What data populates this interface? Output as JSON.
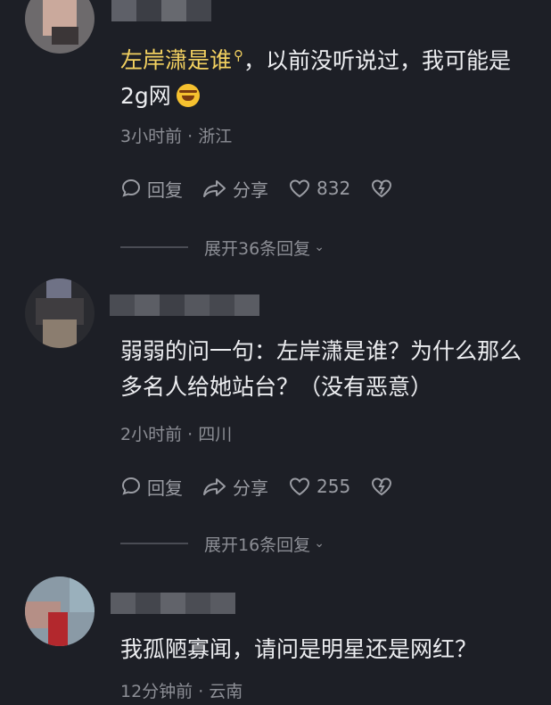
{
  "colors": {
    "background": "#1d1f26",
    "highlight": "#f3d160",
    "text": "#ecedf0",
    "meta": "#8c8e95"
  },
  "comments": [
    {
      "mention": "左岸潇是谁",
      "text": "，以前没听说过，我可能是2g网",
      "meta": "3小时前 · 浙江",
      "reply_label": "回复",
      "share_label": "分享",
      "likes": "832",
      "expand_label": "展开36条回复"
    },
    {
      "text": "弱弱的问一句：左岸潇是谁？为什么那么多名人给她站台？（没有恶意）",
      "meta": "2小时前 · 四川",
      "reply_label": "回复",
      "share_label": "分享",
      "likes": "255",
      "expand_label": "展开16条回复"
    },
    {
      "text": "我孤陋寡闻，请问是明星还是网红？",
      "meta": "12分钟前 · 云南"
    }
  ],
  "icons": [
    "search-icon",
    "comment-icon",
    "share-icon",
    "heart-icon",
    "dislike-icon",
    "chevron-down-icon"
  ]
}
